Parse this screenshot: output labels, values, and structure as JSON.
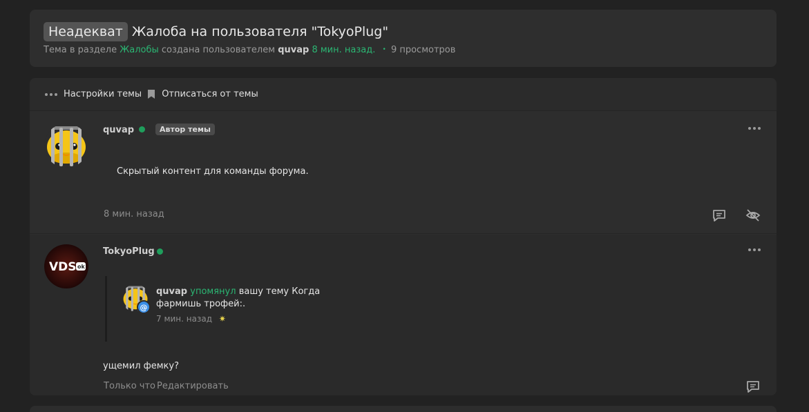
{
  "thread": {
    "prefix": "Неадекват",
    "title": "Жалоба на пользователя \"TokyoPlug\"",
    "meta_prefix": "Тема в разделе",
    "section": "Жалобы",
    "meta_created": "создана пользователем",
    "author": "quvap",
    "time_ago": "8 мин. назад.",
    "dot": "•",
    "views": "9 просмотров"
  },
  "toolbar": {
    "settings_label": "Настройки темы",
    "unsubscribe_label": "Отписаться от темы"
  },
  "posts": [
    {
      "author": "quvap",
      "badge": "Автор темы",
      "content": "Скрытый контент для команды форума.",
      "date": "8 мин. назад"
    },
    {
      "author": "TokyoPlug",
      "avatar_text": "VDS",
      "avatar_subtext": "ok",
      "mention": {
        "user": "quvap",
        "action": "упомянул",
        "text": "вашу тему Когда фармишь трофей:.",
        "date": "7 мин. назад",
        "star": "✷",
        "badge": "@"
      },
      "content": "ущемил фемку?",
      "just_now": "Только что",
      "edit": "Редактировать"
    }
  ],
  "colors": {
    "accent_green": "#2bb673",
    "online": "#1f9e5c",
    "mention_badge": "#3a8ee6"
  },
  "icons": [
    "dots-icon",
    "bookmark-icon",
    "reply-icon",
    "hide-icon",
    "more-icon",
    "mention-icon"
  ]
}
